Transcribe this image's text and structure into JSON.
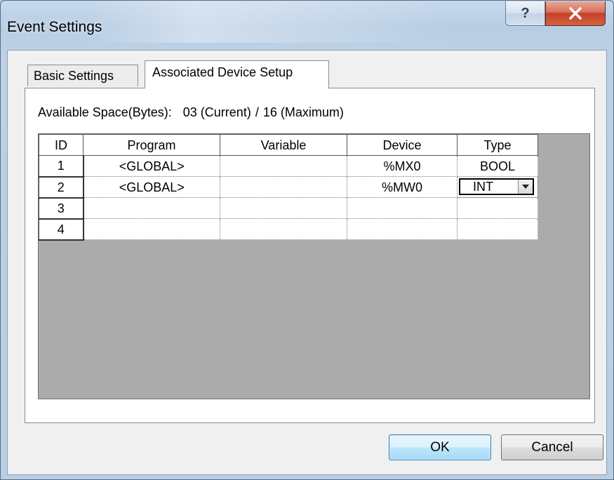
{
  "window": {
    "title": "Event Settings"
  },
  "tabs": [
    {
      "label": "Basic Settings",
      "active": false
    },
    {
      "label": "Associated Device Setup",
      "active": true
    }
  ],
  "space": {
    "label": "Available Space(Bytes):",
    "current": "03 (Current)",
    "separator": "/",
    "maximum": "16 (Maximum)"
  },
  "table": {
    "headers": [
      "ID",
      "Program",
      "Variable",
      "Device",
      "Type"
    ],
    "rows": [
      {
        "id": "1",
        "program": "<GLOBAL>",
        "variable": "",
        "device": "%MX0",
        "type": "BOOL"
      },
      {
        "id": "2",
        "program": "<GLOBAL>",
        "variable": "",
        "device": "%MW0",
        "type": "INT"
      },
      {
        "id": "3",
        "program": "",
        "variable": "",
        "device": "",
        "type": ""
      },
      {
        "id": "4",
        "program": "",
        "variable": "",
        "device": "",
        "type": ""
      }
    ]
  },
  "buttons": {
    "ok": "OK",
    "cancel": "Cancel"
  },
  "icons": {
    "help": "question-mark-icon",
    "close": "close-x-icon",
    "dropdown": "chevron-down-icon"
  },
  "colors": {
    "close_button": "#c8462c",
    "ok_button_border": "#3c7fb1",
    "title_bar": "#c6d8ec"
  }
}
